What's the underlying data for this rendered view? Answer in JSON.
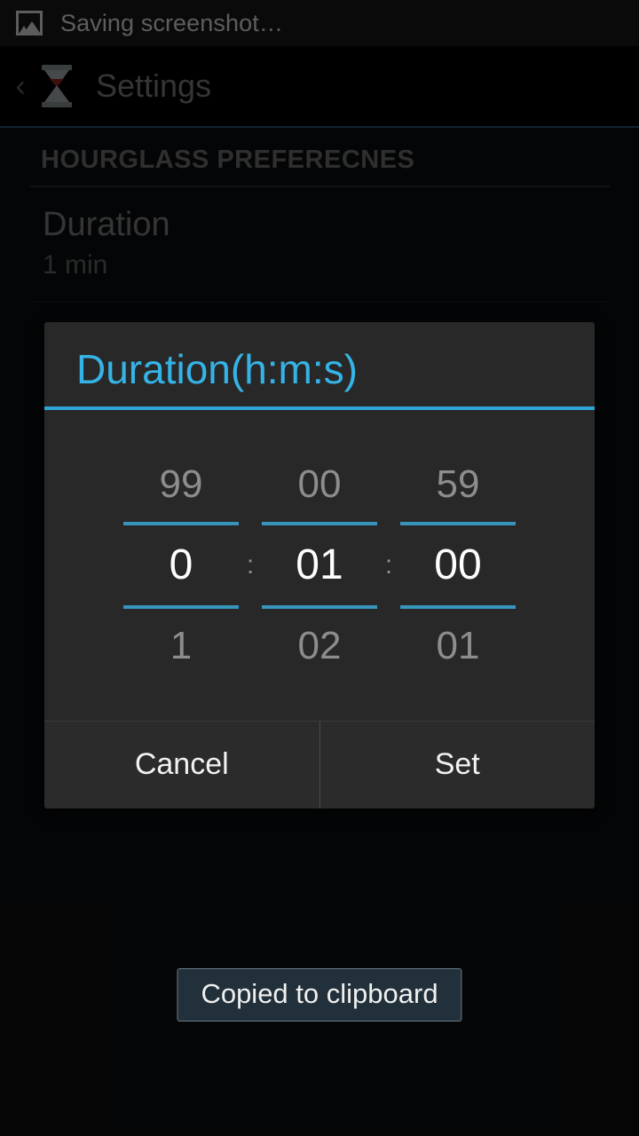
{
  "status_bar": {
    "icon": "screenshot-image-icon",
    "text": "Saving screenshot…"
  },
  "action_bar": {
    "back_icon": "‹",
    "app_icon": "hourglass-icon",
    "title": "Settings"
  },
  "settings": {
    "section_header": "HOURGLASS PREFERECNES",
    "preferences": [
      {
        "title": "Duration",
        "summary": "1 min"
      }
    ]
  },
  "dialog": {
    "title": "Duration(h:m:s)",
    "separator": ":",
    "pickers": [
      {
        "name": "hours",
        "above": "99",
        "value": "0",
        "below": "1"
      },
      {
        "name": "minutes",
        "above": "00",
        "value": "01",
        "below": "02"
      },
      {
        "name": "seconds",
        "above": "59",
        "value": "00",
        "below": "01"
      }
    ],
    "buttons": {
      "cancel": "Cancel",
      "set": "Set"
    }
  },
  "toast": {
    "text": "Copied to clipboard"
  },
  "colors": {
    "accent_blue": "#36b3e6",
    "picker_line": "#3794bd",
    "action_bar_underline": "#2c5c79",
    "dialog_bg": "#282828",
    "toast_bg": "#21303a"
  }
}
